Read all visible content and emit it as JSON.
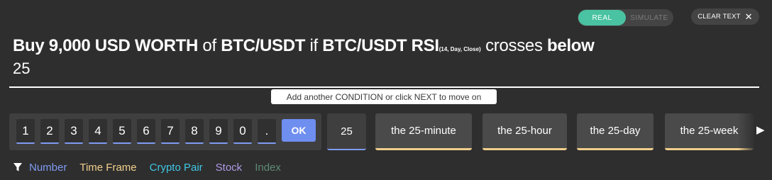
{
  "mode": {
    "real": "REAL",
    "simulate": "SIMULATE",
    "active": "REAL"
  },
  "clear": {
    "label": "CLEAR TEXT",
    "icon": "close-icon"
  },
  "sentence": {
    "buy": "Buy 9,000 USD WORTH",
    "of": "of",
    "pair": "BTC/USDT",
    "if": "if",
    "indicator": "BTC/USDT RSI",
    "params": "(14, Day, Close)",
    "crosses": "crosses",
    "direction": "below",
    "value": "25"
  },
  "hint": "Add another CONDITION or click NEXT to move on",
  "keypad": {
    "keys": [
      "1",
      "2",
      "3",
      "4",
      "5",
      "6",
      "7",
      "8",
      "9",
      "0",
      "."
    ],
    "ok": "OK"
  },
  "suggestions": {
    "value": "25",
    "timeframes": [
      "the 25-minute",
      "the 25-hour",
      "the 25-day",
      "the 25-week"
    ],
    "next_icon": "chevron-right-icon"
  },
  "filters": [
    {
      "label": "Number",
      "color": "#7f9bf2"
    },
    {
      "label": "Time Frame",
      "color": "#f1cf8d"
    },
    {
      "label": "Crypto Pair",
      "color": "#3fc7e6"
    },
    {
      "label": "Stock",
      "color": "#b09ae6"
    },
    {
      "label": "Index",
      "color": "#5f8a74"
    }
  ],
  "colors": {
    "background": "#2e2e2e",
    "accent_real": "#49c3a1",
    "ok_button": "#6e8ef0"
  }
}
